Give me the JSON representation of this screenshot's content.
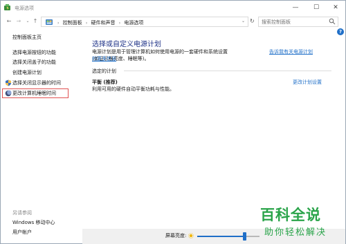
{
  "window": {
    "title": "电源选项",
    "min_glyph": "—",
    "max_glyph": "☐",
    "close_glyph": "✕"
  },
  "address": {
    "back": "←",
    "forward": "→",
    "dropdown": "⌄",
    "up": "↑",
    "crumbs": [
      "控制面板",
      "硬件和声音",
      "电源选项"
    ],
    "crumb_sep": "›",
    "refresh": "↻",
    "search_placeholder": "搜索控制面板"
  },
  "help": "?",
  "sidebar": {
    "home": "控制面板主页",
    "items": [
      {
        "label": "选择电源按钮的功能"
      },
      {
        "label": "选择关闭盖子的功能"
      },
      {
        "label": "创建电源计划"
      },
      {
        "label": "选择关闭显示器的时间",
        "icon": "shield-icon"
      },
      {
        "label": "更改计算机睡眠时间",
        "icon": "moon-icon",
        "selected": true
      }
    ],
    "see_also": "另请参阅",
    "bottom": [
      {
        "label": "Windows 移动中心"
      },
      {
        "label": "用户帐户"
      }
    ]
  },
  "main": {
    "title": "选择或自定义电源计划",
    "description": "电源计划是用于管理计算机如何使用电源的一套硬件和系统设置(如显示器亮度、睡眠等)。",
    "link_text_1": "告诉我有关电源计划",
    "link_text_2": "的更多信息",
    "selected_plan_label": "选定的计划",
    "plan_name": "平衡 (推荐)",
    "plan_desc": "利用可用的硬件自动平衡功耗与性能。",
    "plan_settings": "更改计划设置"
  },
  "status": {
    "brightness_label": "屏幕亮度:",
    "brightness_value": 0.75
  },
  "watermark": {
    "main": "百科全说",
    "sub": "助你轻松解决"
  },
  "colors": {
    "accent": "#1f6fc8",
    "title_blue": "#1e3287",
    "watermark": "#2aa44a",
    "selection_border": "#e05050"
  }
}
